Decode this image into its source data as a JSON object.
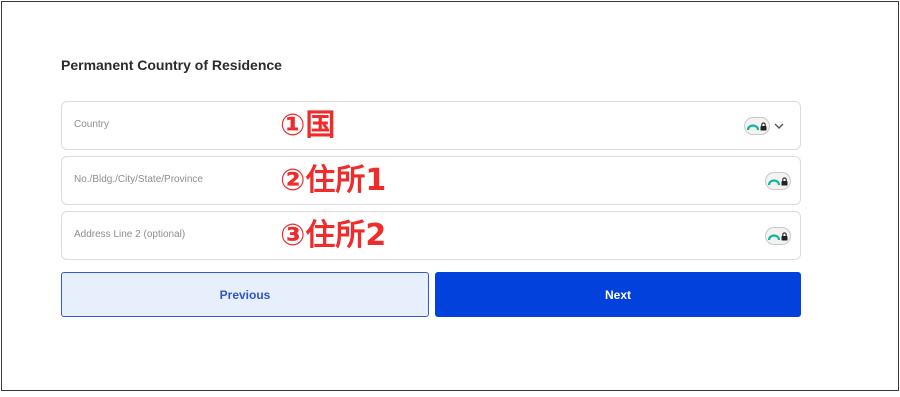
{
  "form": {
    "section_title": "Permanent Country of Residence",
    "fields": [
      {
        "placeholder": "Country",
        "annotation": "①国",
        "has_dropdown": true
      },
      {
        "placeholder": "No./Bldg./City/State/Province",
        "annotation": "②住所1",
        "has_dropdown": false
      },
      {
        "placeholder": "Address Line 2 (optional)",
        "annotation": "③住所2",
        "has_dropdown": false
      }
    ]
  },
  "buttons": {
    "previous_label": "Previous",
    "next_label": "Next"
  },
  "icons": {
    "autofill": "password-manager-icon",
    "dropdown": "chevron-down-icon"
  },
  "colors": {
    "annotation": "#ef2b2b",
    "primary": "#0341dc",
    "secondary_bg": "#e8effc",
    "pm_icon_teal": "#13b59a"
  }
}
